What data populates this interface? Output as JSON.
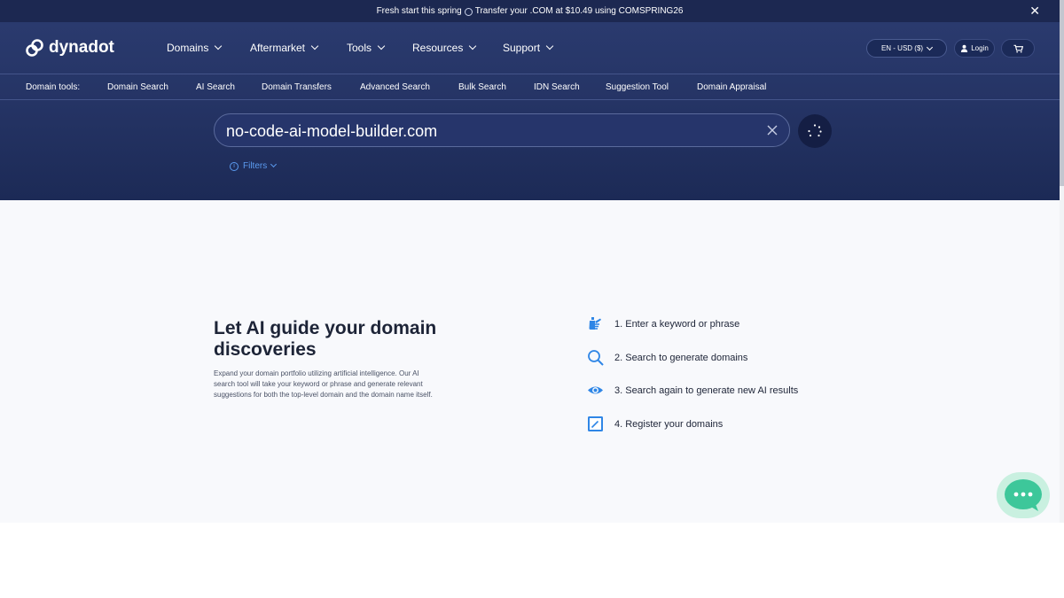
{
  "promo": {
    "text_before": "Fresh start this spring",
    "text_after": "Transfer your .COM at $10.49 using COMSPRING26",
    "clock_icon": "clock-icon",
    "close_icon": "close-icon"
  },
  "brand": {
    "name": "dynadot",
    "logo_icon": "dynadot-logo-icon"
  },
  "nav": {
    "items": [
      {
        "label": "Domains"
      },
      {
        "label": "Aftermarket"
      },
      {
        "label": "Tools"
      },
      {
        "label": "Resources"
      },
      {
        "label": "Support"
      }
    ],
    "lang_currency": "EN - USD ($)",
    "login": "Login",
    "cart_icon": "cart-icon",
    "user_icon": "user-icon"
  },
  "tools": {
    "label": "Domain tools:",
    "links": [
      {
        "label": "Domain Search"
      },
      {
        "label": "AI Search"
      },
      {
        "label": "Domain Transfers"
      },
      {
        "label": "Advanced Search"
      },
      {
        "label": "Bulk Search"
      },
      {
        "label": "IDN Search"
      },
      {
        "label": "Suggestion Tool"
      },
      {
        "label": "Domain Appraisal"
      }
    ]
  },
  "search": {
    "value": "no-code-ai-model-builder.com",
    "clear_icon": "clear-icon",
    "loading_icon": "loading-spinner-icon",
    "filters_label": "Filters",
    "filters_icon": "info-icon"
  },
  "intro": {
    "heading": "Let AI guide your domain discoveries",
    "description": "Expand your domain portfolio utilizing artificial intelligence. Our AI search tool will take your keyword or phrase and generate relevant suggestions for both the top-level domain and the domain name itself."
  },
  "steps": [
    {
      "label": "1. Enter a keyword or phrase",
      "icon": "hand-keyword-icon"
    },
    {
      "label": "2. Search to generate domains",
      "icon": "search-icon"
    },
    {
      "label": "3. Search again to generate new AI results",
      "icon": "eye-icon"
    },
    {
      "label": "4. Register your domains",
      "icon": "edit-icon"
    }
  ],
  "chat": {
    "icon": "chat-bubble-icon"
  },
  "colors": {
    "header_bg": "#253465",
    "promo_bg": "#1c2851",
    "accent_blue": "#2f86e6",
    "filter_blue": "#5b9bf0",
    "chat_green": "#3dc79a"
  }
}
